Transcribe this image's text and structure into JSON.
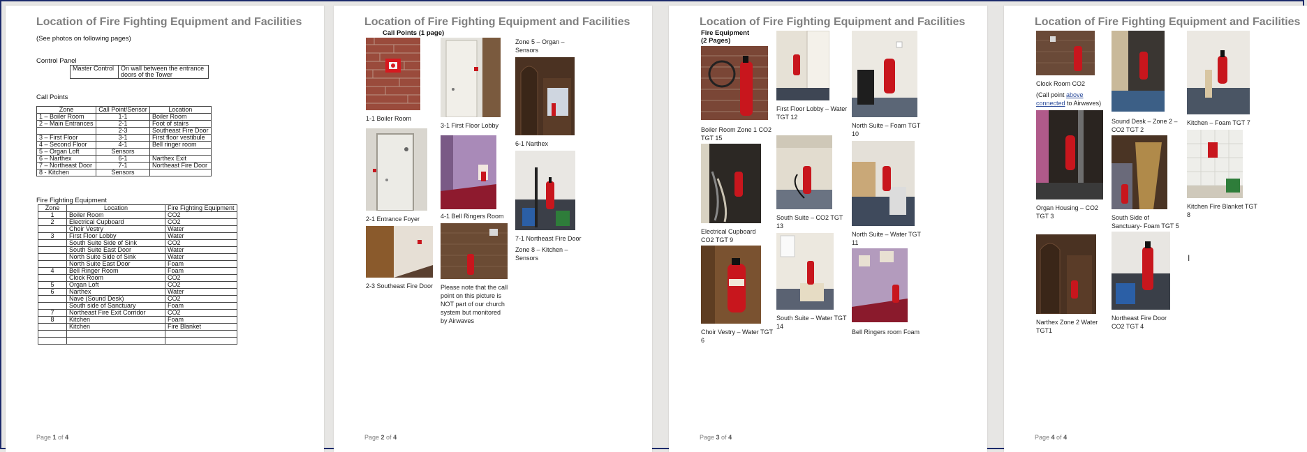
{
  "title": "Location of Fire Fighting Equipment and Facilities",
  "pages": [
    {
      "footer_prefix": "Page ",
      "num": "1",
      "of": " of ",
      "total": "4"
    },
    {
      "footer_prefix": "Page ",
      "num": "2",
      "of": " of ",
      "total": "4"
    },
    {
      "footer_prefix": "Page ",
      "num": "3",
      "of": " of ",
      "total": "4"
    },
    {
      "footer_prefix": "Page ",
      "num": "4",
      "of": " of ",
      "total": "4"
    }
  ],
  "page1": {
    "note": "(See photos on following pages)",
    "control_panel": {
      "heading": "Control Panel",
      "label": "Master Control",
      "location_line1": "On wall between the entrance",
      "location_line2": "doors of the Tower"
    },
    "call_points": {
      "heading": "Call Points",
      "headers": [
        "Zone",
        "Call Point/Sensor",
        "Location"
      ],
      "rows": [
        [
          "1 – Boiler Room",
          "1-1",
          "Boiler Room"
        ],
        [
          "2 – Main Entrances",
          "2-1",
          "Foot of stairs"
        ],
        [
          "",
          "2-3",
          "Southeast Fire Door"
        ],
        [
          "3 – First Floor",
          "3-1",
          "First floor vestibule"
        ],
        [
          "4 – Second Floor",
          "4-1",
          "Bell ringer room"
        ],
        [
          "5 – Organ Loft",
          "Sensors",
          ""
        ],
        [
          "6 – Narthex",
          "6-1",
          "Narthex Exit"
        ],
        [
          "7 – Northeast Door",
          "7-1",
          "Northeast Fire Door"
        ],
        [
          "8 - Kitchen",
          "Sensors",
          ""
        ]
      ]
    },
    "equipment": {
      "heading": "Fire Fighting Equipment",
      "headers": [
        "Zone",
        "Location",
        "Fire Fighting Equipment"
      ],
      "rows": [
        [
          "1",
          "Boiler Room",
          "CO2"
        ],
        [
          "2",
          "Electrical Cupboard",
          "CO2"
        ],
        [
          "",
          "Choir Vestry",
          "Water"
        ],
        [
          "3",
          "First Floor Lobby",
          "Water"
        ],
        [
          "",
          "South Suite Side of Sink",
          "CO2"
        ],
        [
          "",
          "South Suite East Door",
          "Water"
        ],
        [
          "",
          "North Suite Side of Sink",
          "Water"
        ],
        [
          "",
          "North Suite East Door",
          "Foam"
        ],
        [
          "4",
          "Bell Ringer Room",
          "Foam"
        ],
        [
          "",
          "Clock Room",
          "CO2"
        ],
        [
          "5",
          "Organ Loft",
          "CO2"
        ],
        [
          "6",
          "Narthex",
          "Water"
        ],
        [
          "",
          "Nave (Sound Desk)",
          "CO2"
        ],
        [
          "",
          "South side of Sanctuary",
          "Foam"
        ],
        [
          "7",
          "Northeast Fire Exit Corridor",
          "CO2"
        ],
        [
          "8",
          "Kitchen",
          "Foam"
        ],
        [
          "",
          "Kitchen",
          "Fire Blanket"
        ],
        [
          "",
          "",
          ""
        ],
        [
          "",
          "",
          ""
        ]
      ]
    }
  },
  "page2": {
    "heading": "Call Points (1 page)",
    "captions": {
      "boiler": "1-1 Boiler Room",
      "lobby": "3-1 First Floor Lobby",
      "zone5": [
        "Zone 5 – Organ –",
        "Sensors"
      ],
      "narthex": "6-1 Narthex",
      "foyer": "2-1 Entrance Foyer",
      "bell": "4-1 Bell Ringers Room",
      "northeast": "7-1 Northeast Fire Door",
      "zone8": [
        "Zone 8 – Kitchen –",
        "Sensors"
      ],
      "southeast": "2-3 Southeast Fire Door",
      "note": [
        "Please note that the call",
        "point on this picture is",
        "NOT part of our church",
        "system but monitored",
        "by Airwaves"
      ]
    }
  },
  "page3": {
    "heading": [
      "Fire Equipment",
      "(2 Pages)"
    ],
    "captions": {
      "boiler": [
        "Boiler Room Zone 1 CO2",
        "TGT 15"
      ],
      "lobby": [
        "First Floor Lobby – Water",
        "TGT 12"
      ],
      "north_foam": [
        "North Suite – Foam TGT",
        "10"
      ],
      "electrical": [
        "Electrical Cupboard",
        "CO2 TGT 9"
      ],
      "south_co2": [
        "South Suite – CO2 TGT",
        "13"
      ],
      "north_water": [
        "North Suite – Water TGT",
        "11"
      ],
      "choir": [
        "Choir Vestry – Water TGT",
        "6"
      ],
      "south_water": [
        "South Suite – Water TGT",
        "14"
      ],
      "bell_foam": [
        "Bell Ringers room Foam"
      ]
    }
  },
  "page4": {
    "captions": {
      "clock": "Clock Room CO2",
      "clock_note_a": "(Call point ",
      "clock_note_link": "above",
      "clock_note_b": "connected",
      "clock_note_c": " to Airwaves)",
      "sound": [
        "Sound Desk – Zone 2 –",
        "CO2 TGT 2"
      ],
      "kitchen_foam": "Kitchen – Foam TGT 7",
      "organ": [
        "Organ Housing – CO2",
        "TGT 3"
      ],
      "sanctuary": [
        "South Side of",
        "Sanctuary- Foam TGT 5"
      ],
      "blanket": [
        "Kitchen Fire Blanket TGT",
        "8"
      ],
      "narthex": [
        "Narthex Zone 2 Water",
        "TGT1"
      ],
      "ne_door": [
        "Northeast Fire Door",
        "CO2 TGT 4"
      ],
      "cursor": "I"
    }
  },
  "colors": {
    "title_gray": "#7f7f7f",
    "frame_navy": "#1c2a6b",
    "extinguisher_red": "#c8161d"
  }
}
